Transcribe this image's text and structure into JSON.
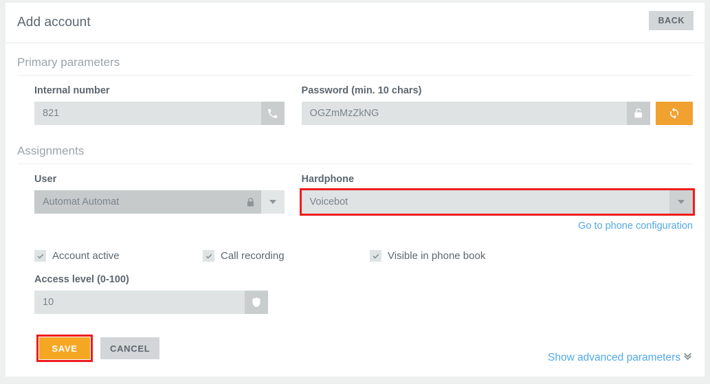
{
  "header": {
    "title": "Add account",
    "back_label": "BACK"
  },
  "sections": {
    "primary": {
      "heading": "Primary parameters",
      "internal_number": {
        "label": "Internal number",
        "value": "821",
        "icon": "phone-icon"
      },
      "password": {
        "label": "Password (min. 10 chars)",
        "value": "OGZmMzZkNG",
        "icon": "unlocked-padlock-icon",
        "regenerate_icon": "refresh-icon"
      }
    },
    "assignments": {
      "heading": "Assignments",
      "user": {
        "label": "User",
        "value": "Automat Automat",
        "icon": "locked-padlock-icon",
        "arrow_icon": "chevron-down-icon"
      },
      "hardphone": {
        "label": "Hardphone",
        "value": "Voicebot",
        "arrow_icon": "chevron-down-icon",
        "link": "Go to phone configuration"
      }
    }
  },
  "checkboxes": [
    {
      "label": "Account active",
      "checked": true
    },
    {
      "label": "Call recording",
      "checked": true
    },
    {
      "label": "Visible in phone book",
      "checked": true
    }
  ],
  "access_level": {
    "label": "Access level (0-100)",
    "value": "10",
    "icon": "shield-icon"
  },
  "advanced": {
    "label": "Show advanced parameters",
    "icon": "double-chevron-down-icon"
  },
  "actions": {
    "save_label": "SAVE",
    "cancel_label": "CANCEL"
  },
  "colors": {
    "accent_orange": "#f5a623",
    "highlight_red": "#ee1c1c",
    "link_blue": "#52a9e8",
    "field_gray": "#dfe3e3",
    "text_gray": "#5c6670"
  }
}
